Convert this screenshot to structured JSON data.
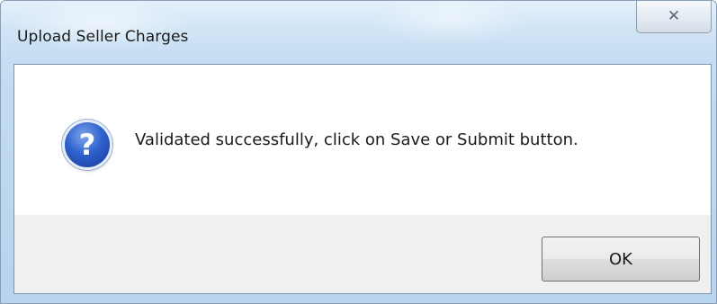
{
  "dialog": {
    "title": "Upload Seller Charges",
    "close_glyph": "✕",
    "icon": "question-icon",
    "icon_glyph": "?",
    "message": "Validated successfully, click on Save or Submit button.",
    "ok_label": "OK"
  }
}
